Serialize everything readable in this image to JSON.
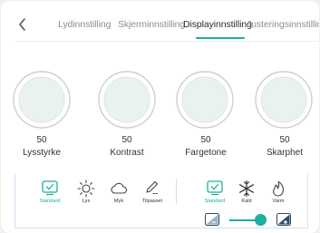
{
  "tabs": [
    {
      "label": "Lydinnstilling",
      "active": false
    },
    {
      "label": "Skjerminnstilling",
      "active": false
    },
    {
      "label": "Displayinnstilling",
      "active": true
    },
    {
      "label": "Justeringsinnstilling",
      "active": false
    }
  ],
  "dials": [
    {
      "value": "50",
      "label": "Lysstyrke"
    },
    {
      "value": "50",
      "label": "Kontrast"
    },
    {
      "value": "50",
      "label": "Fargetone"
    },
    {
      "value": "50",
      "label": "Skarphet"
    }
  ],
  "picture_modes": [
    {
      "label": "Standard",
      "icon": "check-monitor-icon",
      "selected": true
    },
    {
      "label": "Lys",
      "icon": "sun-icon",
      "selected": false
    },
    {
      "label": "Myk",
      "icon": "cloud-icon",
      "selected": false
    },
    {
      "label": "Tilpasset",
      "icon": "pencil-icon",
      "selected": false
    }
  ],
  "color_temps": [
    {
      "label": "Standard",
      "icon": "check-monitor-icon",
      "selected": true
    },
    {
      "label": "Kald",
      "icon": "snowflake-icon",
      "selected": false
    },
    {
      "label": "Varm",
      "icon": "flame-icon",
      "selected": false
    }
  ],
  "backlight_slider": {
    "level": 0.85
  },
  "colors": {
    "accent": "#1dae9c",
    "accent_light": "#e6f7f5",
    "text": "#333333",
    "muted": "#8e8e8e"
  }
}
